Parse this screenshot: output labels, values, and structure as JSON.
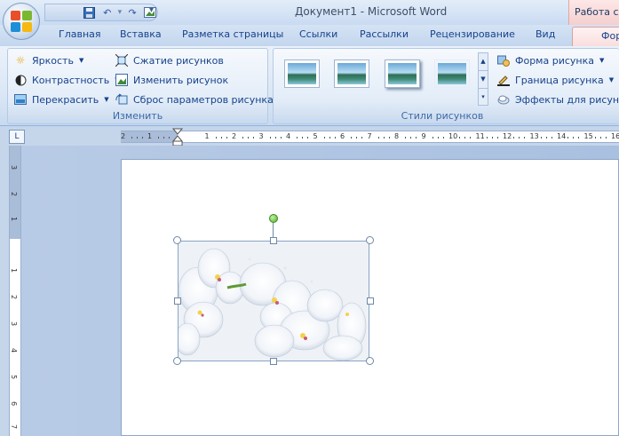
{
  "window": {
    "title": "Документ1 - Microsoft Word",
    "context_title": "Работа с р"
  },
  "quick_access": {
    "save_icon": "save-icon",
    "undo_icon": "undo-icon",
    "redo_icon": "redo-icon",
    "insert_picture_icon": "picture-icon",
    "customize_icon": "chevron-down-icon"
  },
  "tabs": [
    {
      "label": "Главная"
    },
    {
      "label": "Вставка"
    },
    {
      "label": "Разметка страницы"
    },
    {
      "label": "Ссылки"
    },
    {
      "label": "Рассылки"
    },
    {
      "label": "Рецензирование"
    },
    {
      "label": "Вид"
    }
  ],
  "active_tab": {
    "label": "Формат"
  },
  "ribbon": {
    "adjust_group": {
      "label": "Изменить",
      "brightness": "Яркость",
      "contrast": "Контрастность",
      "recolor": "Перекрасить",
      "compress": "Сжатие рисунков",
      "change_picture": "Изменить рисунок",
      "reset_picture": "Сброс параметров рисунка"
    },
    "styles_group": {
      "label": "Стили рисунков",
      "picture_shape": "Форма рисунка",
      "picture_border": "Граница рисунка",
      "picture_effects": "Эффекты для рисунка"
    }
  },
  "ruler": {
    "corner_symbol": "L",
    "h_numbers": [
      "2",
      "1",
      "1",
      "2",
      "3",
      "4",
      "5",
      "6",
      "7",
      "8",
      "9",
      "10",
      "11",
      "12",
      "13",
      "14",
      "15",
      "16"
    ],
    "v_numbers": [
      "3",
      "2",
      "1",
      "1",
      "2",
      "3",
      "4",
      "5",
      "6",
      "7"
    ]
  },
  "colors": {
    "accent": "#15428b",
    "ribbon_bg": "#dbe7f5",
    "context_tab": "#f9dede",
    "selection_handle": "#6e88a8"
  }
}
